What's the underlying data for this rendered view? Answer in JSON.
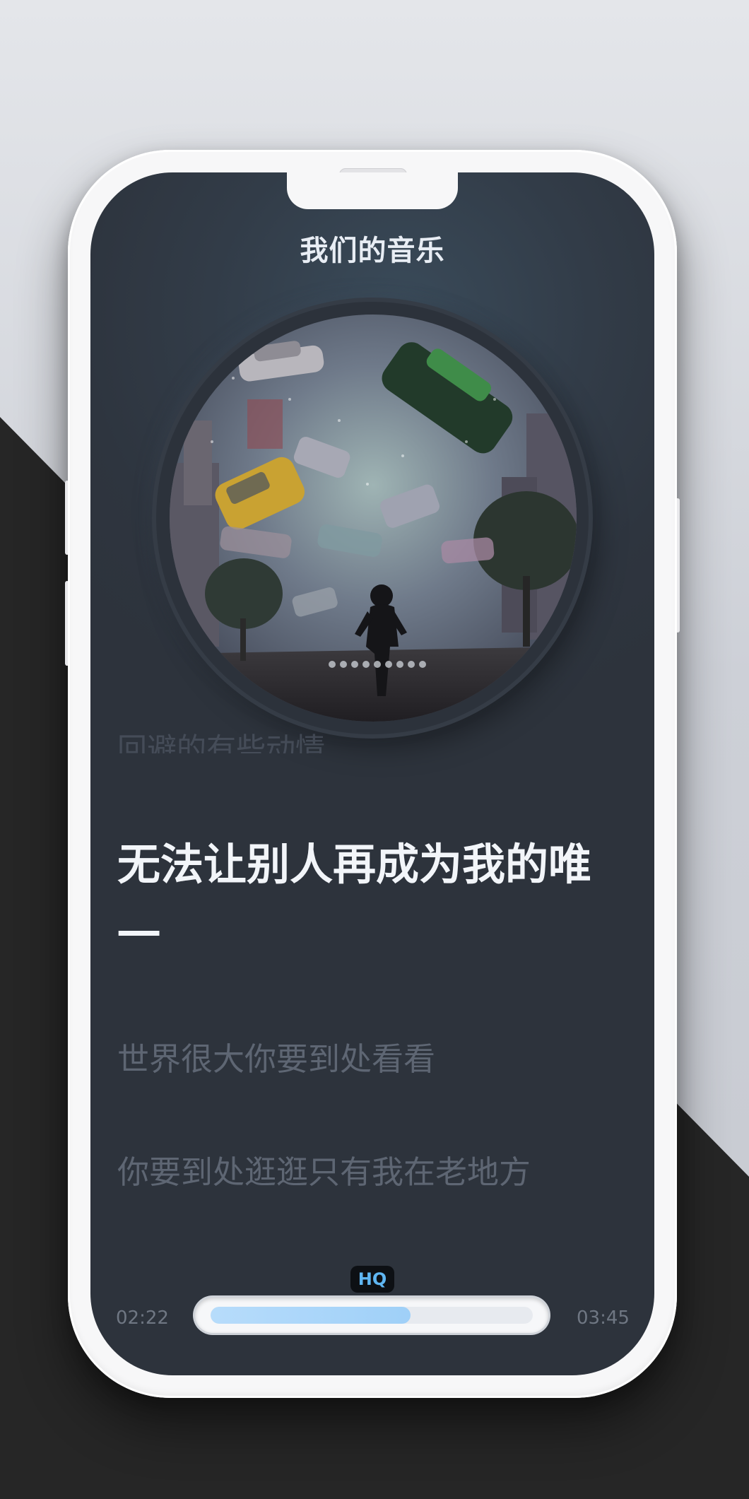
{
  "app": {
    "title": "我们的音乐"
  },
  "player": {
    "quality_badge": "HQ",
    "elapsed": "02:22",
    "duration": "03:45",
    "progress_fraction": 0.62
  },
  "lyrics": {
    "previous": "回避的有些动情",
    "current": "无法让别人再成为我的唯一",
    "next": [
      "世界很大你要到处看看",
      "你要到处逛逛只有我在老地方"
    ]
  },
  "colors": {
    "accent": "#5fb6f2",
    "progress_fill": "#a9d6f9",
    "screen_bg": "#2e353f",
    "lyric_current": "#f2f5f9",
    "lyric_dim": "#5e6673"
  }
}
